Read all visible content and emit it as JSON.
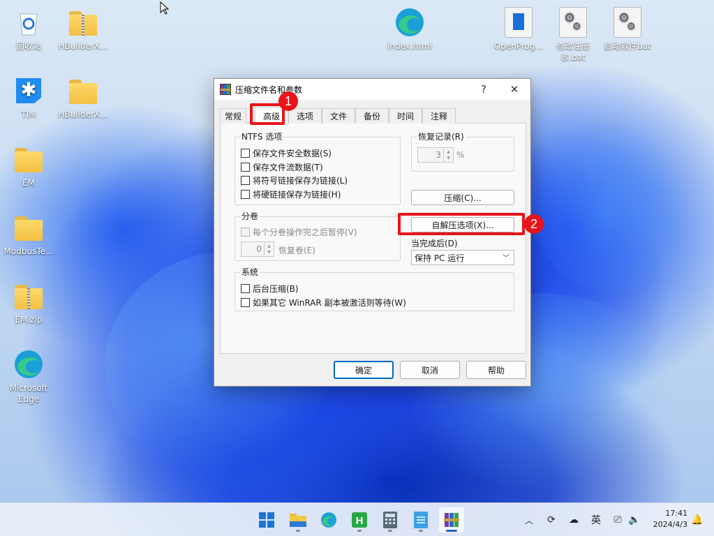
{
  "desktop": {
    "icons": [
      {
        "label": "回收站"
      },
      {
        "label": "HBuilderX..."
      },
      {
        "label": "TIM"
      },
      {
        "label": "HBuilderX..."
      },
      {
        "label": "EM"
      },
      {
        "label": "ModbusTe..."
      },
      {
        "label": "EM.zip"
      },
      {
        "label": "Microsoft Edge"
      },
      {
        "label": "index.html"
      },
      {
        "label": "OpenProg..."
      },
      {
        "label": "修改注册表.bat"
      },
      {
        "label": "启动软件bat"
      }
    ]
  },
  "dialog": {
    "title": "压缩文件名和参数",
    "help_btn": "?",
    "close_btn": "✕",
    "tabs": [
      {
        "label": "常规"
      },
      {
        "label": "高级"
      },
      {
        "label": "选项"
      },
      {
        "label": "文件"
      },
      {
        "label": "备份"
      },
      {
        "label": "时间"
      },
      {
        "label": "注释"
      }
    ],
    "selected_tab": "高级",
    "ntfs": {
      "label": "NTFS 选项",
      "options": [
        {
          "label": "保存文件安全数据(S)",
          "checked": false
        },
        {
          "label": "保存文件流数据(T)",
          "checked": false
        },
        {
          "label": "将符号链接保存为链接(L)",
          "checked": false
        },
        {
          "label": "将硬链接保存为链接(H)",
          "checked": false
        }
      ]
    },
    "recovery": {
      "label": "恢复记录(R)",
      "value": "3",
      "unit": "%"
    },
    "compress_btn": "压缩(C)...",
    "sfx_btn": "自解压选项(X)...",
    "volumes": {
      "label": "分卷",
      "pause_option": "每个分卷操作完之后暂停(V)",
      "recovery_vol_value": "0",
      "recovery_vol_label": "恢复卷(E)"
    },
    "after_done": {
      "label": "当完成后(D)",
      "selected": "保持 PC 运行"
    },
    "system": {
      "label": "系统",
      "options": [
        {
          "label": "后台压缩(B)",
          "checked": false
        },
        {
          "label": "如果其它 WinRAR 副本被激活则等待(W)",
          "checked": false
        }
      ]
    },
    "ok_btn": "确定",
    "cancel_btn": "取消",
    "help_footer_btn": "帮助"
  },
  "annotations": {
    "step1": "1",
    "step2": "2",
    "color": "#e8141a"
  },
  "taskbar": {
    "apps": [
      "start-icon",
      "file-explorer-icon",
      "edge-icon",
      "hbuilderx-icon",
      "calculator-icon",
      "notepad-icon",
      "winrar-icon"
    ],
    "tray": {
      "ime": "英",
      "time": "17:41",
      "date": "2024/4/3"
    }
  }
}
